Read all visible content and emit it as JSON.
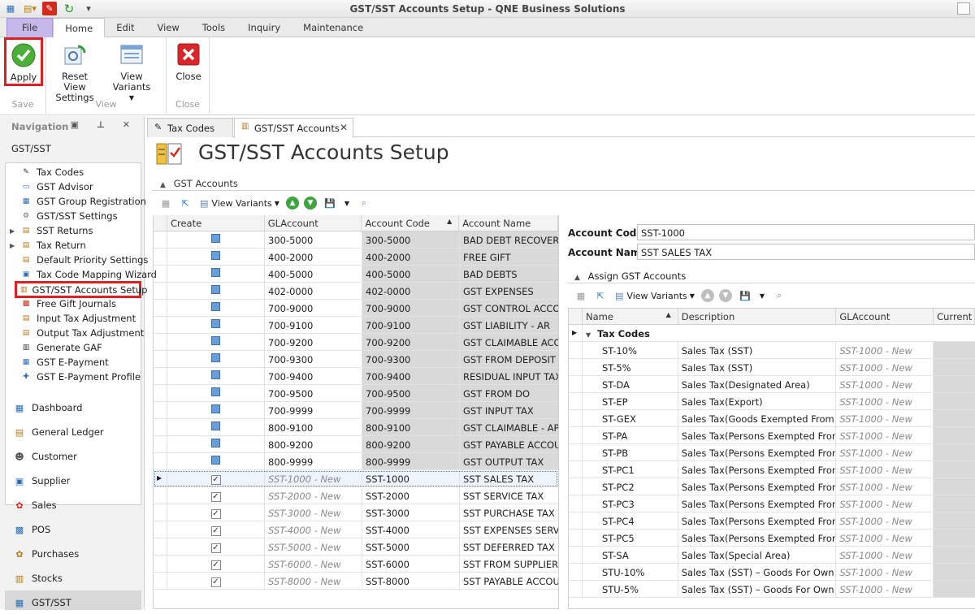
{
  "window": {
    "title": "GST/SST Accounts Setup - QNE Business Solutions"
  },
  "ribbon": {
    "tabs": [
      "File",
      "Home",
      "Edit",
      "View",
      "Tools",
      "Inquiry",
      "Maintenance"
    ],
    "apply_label": "Apply",
    "reset_label": "Reset View Settings",
    "variants_label": "View Variants",
    "close_label": "Close",
    "group_save": "Save",
    "group_view": "View",
    "group_close": "Close"
  },
  "nav": {
    "header": "Navigation",
    "section": "GST/SST",
    "items": [
      {
        "label": "Tax Codes",
        "icon": "tax-codes-icon",
        "exp": false
      },
      {
        "label": "GST Advisor",
        "icon": "monitor-icon",
        "exp": false
      },
      {
        "label": "GST Group Registration",
        "icon": "group-icon",
        "exp": false
      },
      {
        "label": "GST/SST Settings",
        "icon": "settings-icon",
        "exp": false
      },
      {
        "label": "SST Returns",
        "icon": "document-icon",
        "exp": true
      },
      {
        "label": "Tax Return",
        "icon": "document-icon",
        "exp": true
      },
      {
        "label": "Default Priority Settings",
        "icon": "document-icon",
        "exp": false
      },
      {
        "label": "Tax Code Mapping Wizard",
        "icon": "wizard-icon",
        "exp": false
      },
      {
        "label": "GST/SST Accounts Setup",
        "icon": "accounts-setup-icon",
        "exp": false
      },
      {
        "label": "Free Gift Journals",
        "icon": "gift-icon",
        "exp": false
      },
      {
        "label": "Input Tax Adjustment",
        "icon": "document-icon",
        "exp": false
      },
      {
        "label": "Output Tax Adjustment",
        "icon": "document-icon",
        "exp": false
      },
      {
        "label": "Generate GAF",
        "icon": "gaf-icon",
        "exp": false
      },
      {
        "label": "GST E-Payment",
        "icon": "gst-icon",
        "exp": false
      },
      {
        "label": "GST E-Payment Profile",
        "icon": "globe-icon",
        "exp": false
      }
    ],
    "categories": [
      "Dashboard",
      "General Ledger",
      "Customer",
      "Supplier",
      "Sales",
      "POS",
      "Purchases",
      "Stocks",
      "GST/SST"
    ]
  },
  "doc_tabs": [
    "Tax Codes",
    "GST/SST Accounts"
  ],
  "page_title": "GST/SST Accounts Setup",
  "gst_accounts": {
    "section_label": "GST Accounts",
    "view_variants": "View Variants",
    "columns": [
      "Create",
      "GLAccount",
      "Account Code",
      "Account Name"
    ],
    "rows": [
      {
        "create": "box",
        "gl": "300-5000",
        "code": "300-5000",
        "name": "BAD DEBT RECOVERY"
      },
      {
        "create": "box",
        "gl": "400-2000",
        "code": "400-2000",
        "name": "FREE GIFT"
      },
      {
        "create": "box",
        "gl": "400-5000",
        "code": "400-5000",
        "name": "BAD DEBTS"
      },
      {
        "create": "box",
        "gl": "402-0000",
        "code": "402-0000",
        "name": "GST EXPENSES"
      },
      {
        "create": "box",
        "gl": "700-9000",
        "code": "700-9000",
        "name": "GST CONTROL ACCO..."
      },
      {
        "create": "box",
        "gl": "700-9100",
        "code": "700-9100",
        "name": "GST LIABILITY - AR"
      },
      {
        "create": "box",
        "gl": "700-9200",
        "code": "700-9200",
        "name": "GST CLAIMABLE ACC..."
      },
      {
        "create": "box",
        "gl": "700-9300",
        "code": "700-9300",
        "name": "GST FROM DEPOSIT"
      },
      {
        "create": "box",
        "gl": "700-9400",
        "code": "700-9400",
        "name": "RESIDUAL INPUT TAX"
      },
      {
        "create": "box",
        "gl": "700-9500",
        "code": "700-9500",
        "name": "GST FROM DO"
      },
      {
        "create": "box",
        "gl": "700-9999",
        "code": "700-9999",
        "name": "GST INPUT TAX"
      },
      {
        "create": "box",
        "gl": "800-9100",
        "code": "800-9100",
        "name": "GST CLAIMABLE - AP"
      },
      {
        "create": "box",
        "gl": "800-9200",
        "code": "800-9200",
        "name": "GST PAYABLE ACCOU..."
      },
      {
        "create": "box",
        "gl": "800-9999",
        "code": "800-9999",
        "name": "GST OUTPUT TAX"
      },
      {
        "create": "check",
        "gl": "SST-1000 - New",
        "code": "SST-1000",
        "name": "SST SALES TAX",
        "selected": true
      },
      {
        "create": "check",
        "gl": "SST-2000 - New",
        "code": "SST-2000",
        "name": "SST SERVICE TAX"
      },
      {
        "create": "check",
        "gl": "SST-3000 - New",
        "code": "SST-3000",
        "name": "SST PURCHASE TAX"
      },
      {
        "create": "check",
        "gl": "SST-4000 - New",
        "code": "SST-4000",
        "name": "SST EXPENSES SERVI..."
      },
      {
        "create": "check",
        "gl": "SST-5000 - New",
        "code": "SST-5000",
        "name": "SST DEFERRED TAX"
      },
      {
        "create": "check",
        "gl": "SST-6000 - New",
        "code": "SST-6000",
        "name": "SST FROM SUPPLIER..."
      },
      {
        "create": "check",
        "gl": "SST-8000 - New",
        "code": "SST-8000",
        "name": "SST PAYABLE ACCOUNT"
      }
    ]
  },
  "detail": {
    "account_code_label": "Account Code",
    "account_code_value": "SST-1000",
    "account_name_label": "Account Name",
    "account_name_value": "SST SALES TAX"
  },
  "assign": {
    "section_label": "Assign GST Accounts",
    "view_variants": "View Variants",
    "columns": [
      "Name",
      "Description",
      "GLAccount",
      "Current"
    ],
    "group_label": "Tax Codes",
    "rows": [
      {
        "name": "ST-10%",
        "desc": "Sales Tax (SST)",
        "gl": "SST-1000 - New"
      },
      {
        "name": "ST-5%",
        "desc": "Sales Tax (SST)",
        "gl": "SST-1000 - New"
      },
      {
        "name": "ST-DA",
        "desc": "Sales Tax(Designated Area)",
        "gl": "SST-1000 - New"
      },
      {
        "name": "ST-EP",
        "desc": "Sales Tax(Export)",
        "gl": "SST-1000 - New"
      },
      {
        "name": "ST-GEX",
        "desc": "Sales Tax(Goods Exempted From Tax)",
        "gl": "SST-1000 - New"
      },
      {
        "name": "ST-PA",
        "desc": "Sales Tax(Persons Exempted From P...",
        "gl": "SST-1000 - New"
      },
      {
        "name": "ST-PB",
        "desc": "Sales Tax(Persons Exempted From P...",
        "gl": "SST-1000 - New"
      },
      {
        "name": "ST-PC1",
        "desc": "Sales Tax(Persons Exempted From P...",
        "gl": "SST-1000 - New"
      },
      {
        "name": "ST-PC2",
        "desc": "Sales Tax(Persons Exempted From P...",
        "gl": "SST-1000 - New"
      },
      {
        "name": "ST-PC3",
        "desc": "Sales Tax(Persons Exempted From P...",
        "gl": "SST-1000 - New"
      },
      {
        "name": "ST-PC4",
        "desc": "Sales Tax(Persons Exempted From P...",
        "gl": "SST-1000 - New"
      },
      {
        "name": "ST-PC5",
        "desc": "Sales Tax(Persons Exempted From P...",
        "gl": "SST-1000 - New"
      },
      {
        "name": "ST-SA",
        "desc": "Sales Tax(Special Area)",
        "gl": "SST-1000 - New"
      },
      {
        "name": "STU-10%",
        "desc": "Sales Tax (SST) – Goods For Own Us...",
        "gl": "SST-1000 - New"
      },
      {
        "name": "STU-5%",
        "desc": "Sales Tax (SST) – Goods For Own Us...",
        "gl": "SST-1000 - New"
      }
    ]
  }
}
